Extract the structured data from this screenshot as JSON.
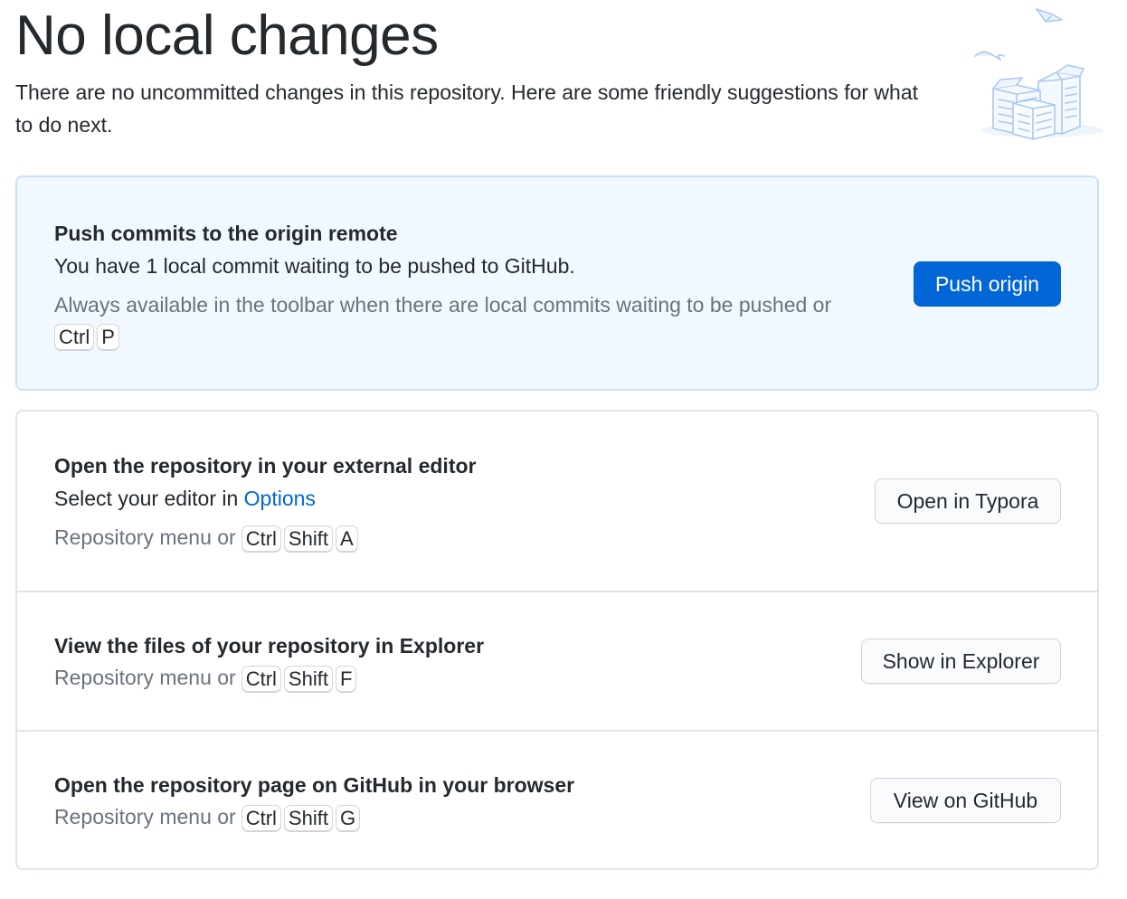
{
  "header": {
    "title": "No local changes",
    "subtitle": "There are no uncommitted changes in this repository. Here are some friendly suggestions for what to do next."
  },
  "push": {
    "title": "Push commits to the origin remote",
    "description": "You have 1 local commit waiting to be pushed to GitHub.",
    "hint": "Always available in the toolbar when there are local commits waiting to be pushed or",
    "keys": [
      "Ctrl",
      "P"
    ],
    "button_label": "Push origin"
  },
  "editor": {
    "title": "Open the repository in your external editor",
    "description_prefix": "Select your editor in",
    "description_link": "Options",
    "hint": "Repository menu or",
    "keys": [
      "Ctrl",
      "Shift",
      "A"
    ],
    "button_label": "Open in Typora"
  },
  "explorer": {
    "title": "View the files of your repository in Explorer",
    "hint": "Repository menu or",
    "keys": [
      "Ctrl",
      "Shift",
      "F"
    ],
    "button_label": "Show in Explorer"
  },
  "github": {
    "title": "Open the repository page on GitHub in your browser",
    "hint": "Repository menu or",
    "keys": [
      "Ctrl",
      "Shift",
      "G"
    ],
    "button_label": "View on GitHub"
  },
  "colors": {
    "accent": "#0366d6",
    "primary_card_bg": "#f1f8ff",
    "primary_card_border": "#c8e1ff",
    "muted_text": "#6a737d"
  },
  "icons": {
    "illustration": "empty-boxes-illustration"
  }
}
